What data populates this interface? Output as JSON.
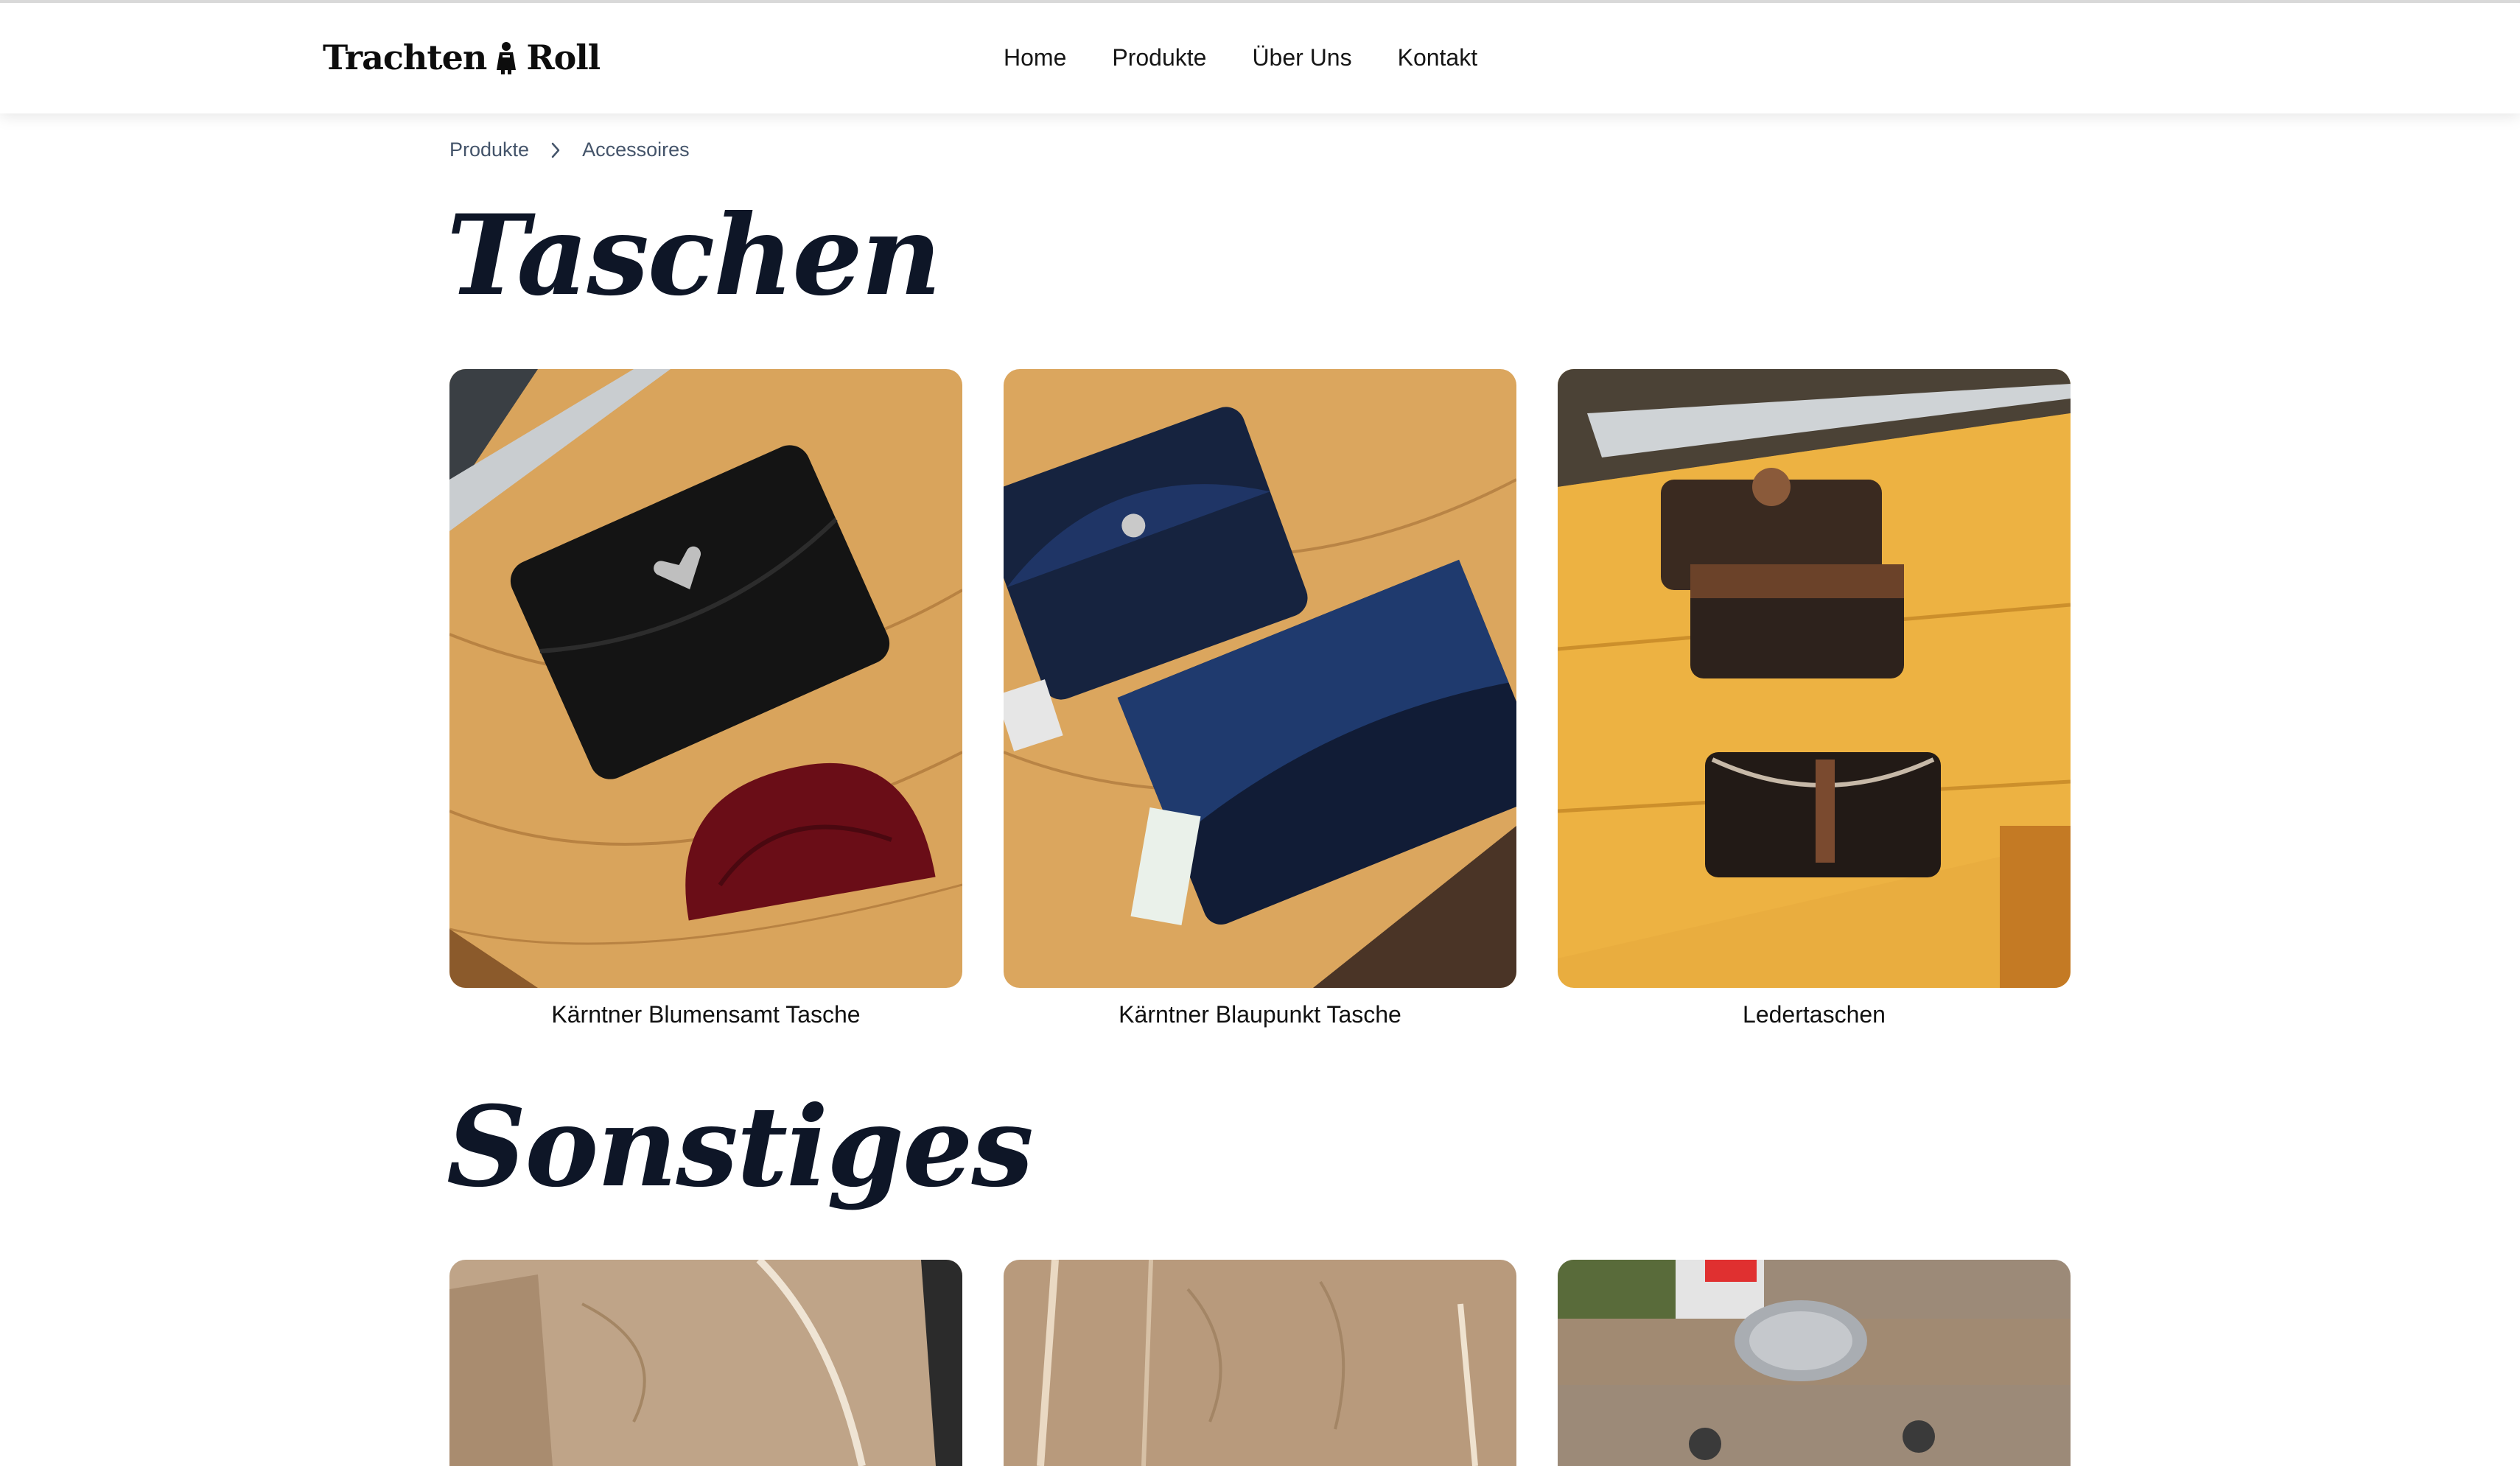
{
  "header": {
    "logo_text_left": "Trachten",
    "logo_text_right": "Roll",
    "nav": [
      "Home",
      "Produkte",
      "Über Uns",
      "Kontakt"
    ]
  },
  "breadcrumb": [
    "Produkte",
    "Accessoires"
  ],
  "sections": [
    {
      "title": "Taschen",
      "products": [
        {
          "name": "Kärntner Blumensamt Tasche",
          "image": "black-and-red-velvet-bags-photo"
        },
        {
          "name": "Kärntner Blaupunkt Tasche",
          "image": "navy-polka-dot-bags-photo"
        },
        {
          "name": "Ledertaschen",
          "image": "leather-belt-bags-photo"
        }
      ]
    },
    {
      "title": "Sonstiges",
      "products": [
        {
          "name": "",
          "image": "suede-lederhose-photo"
        },
        {
          "name": "",
          "image": "suede-lederhose-embroidery-photo"
        },
        {
          "name": "",
          "image": "lederhose-belt-buckle-photo"
        }
      ]
    }
  ],
  "colors": {
    "heading": "#0e1627",
    "breadcrumb": "#44546a",
    "wood": "#e3a54d"
  }
}
